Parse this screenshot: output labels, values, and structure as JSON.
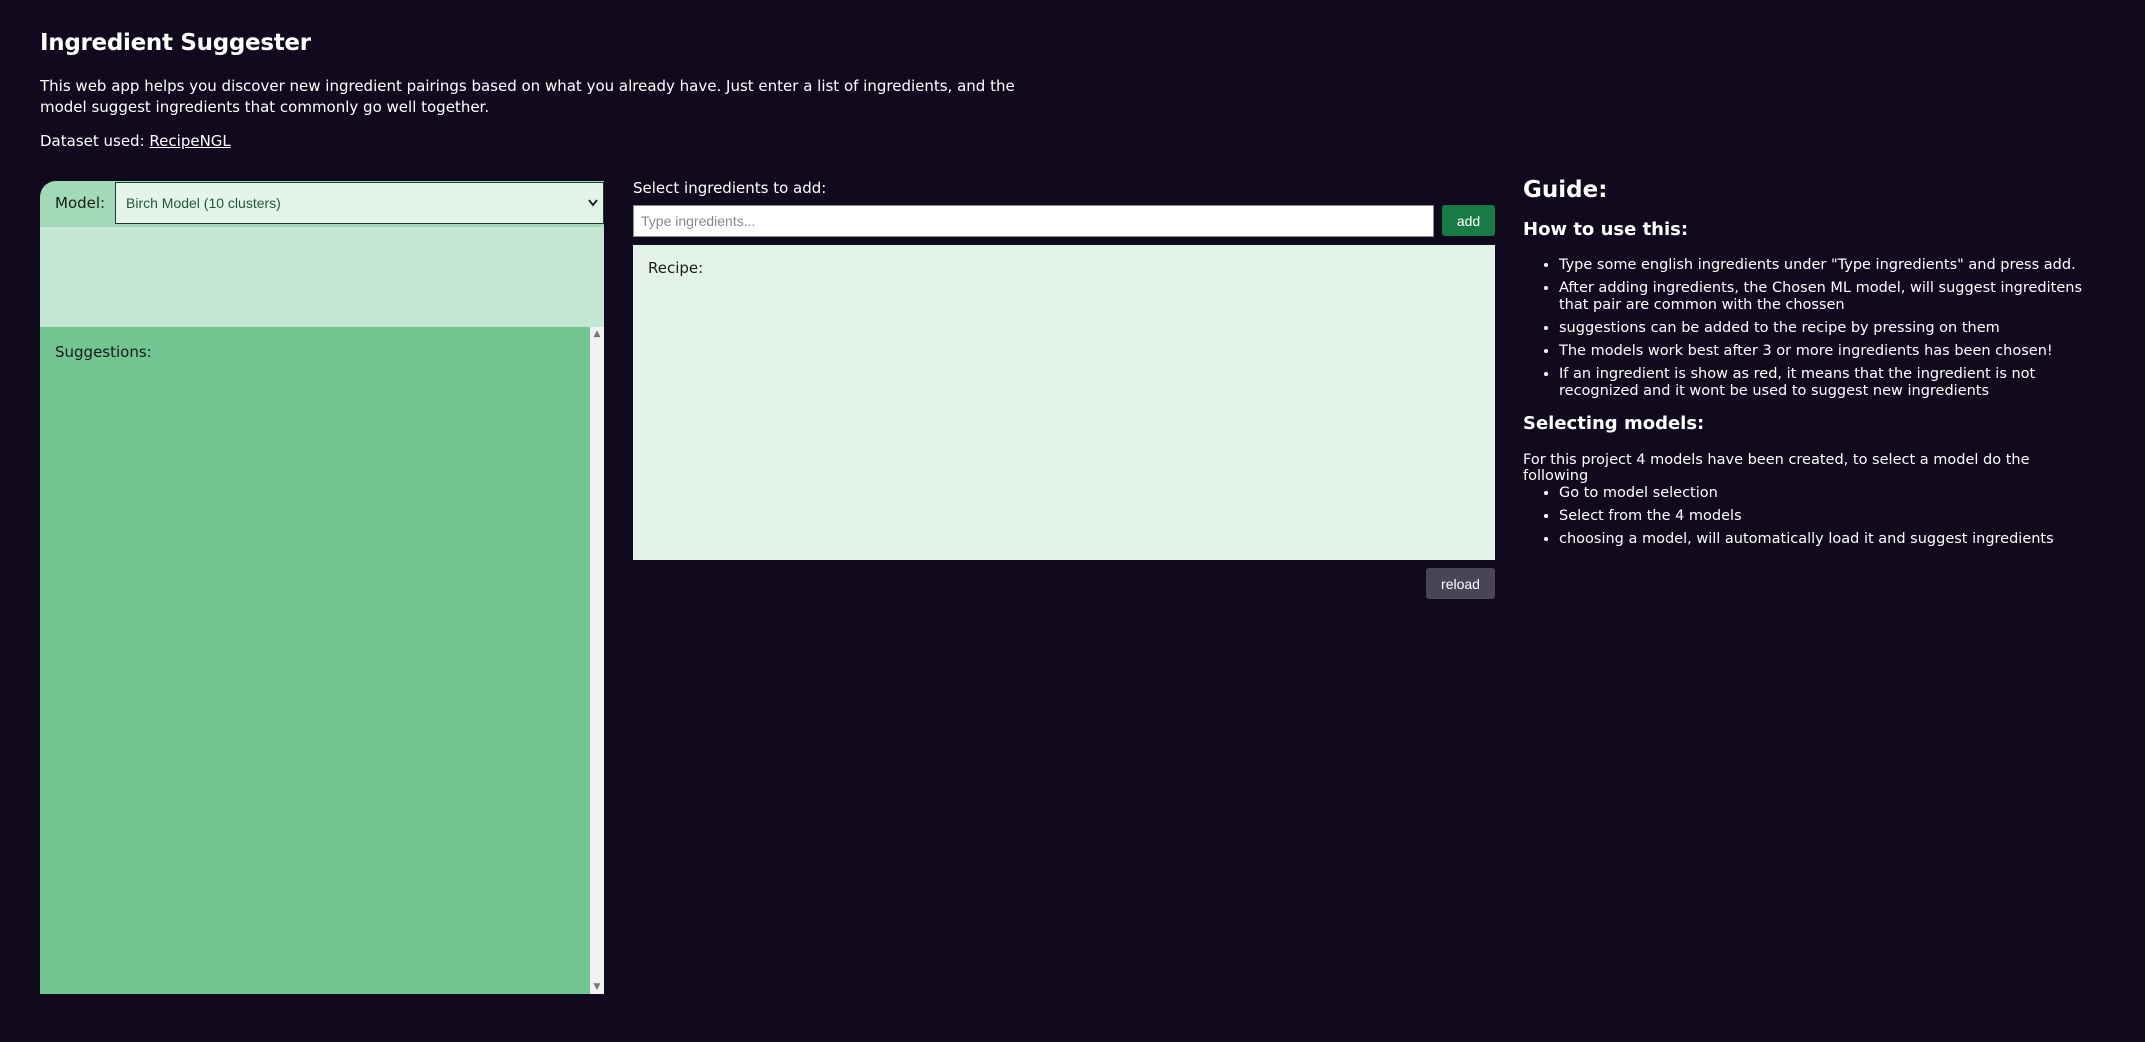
{
  "header": {
    "title": "Ingredient Suggester",
    "description": "This web app helps you discover new ingredient pairings based on what you already have. Just enter a list of ingredients, and the model suggest ingredients that commonly go well together.",
    "dataset_prefix": "Dataset used:",
    "dataset_link": "RecipeNGL"
  },
  "left_panel": {
    "model_label": "Model:",
    "model_selected": "Birch Model (10 clusters)",
    "suggestions_label": "Suggestions:"
  },
  "middle": {
    "select_label": "Select ingredients to add:",
    "input_placeholder": "Type ingredients...",
    "input_value": "",
    "add_label": "add",
    "recipe_label": "Recipe:",
    "reload_label": "reload"
  },
  "guide": {
    "title": "Guide:",
    "how_to_title": "How to use this:",
    "how_to_items": [
      "Type some english ingredients under \"Type ingredients\" and press add.",
      "After adding ingredients, the Chosen ML model, will suggest ingreditens that pair are common with the chossen",
      "suggestions can be added to the recipe by pressing on them",
      "The models work best after 3 or more ingredients has been chosen!",
      "If an ingredient is show as red, it means that the ingredient is not recognized and it wont be used to suggest new ingredients"
    ],
    "selecting_title": "Selecting models:",
    "selecting_intro": "For this project 4 models have been created, to select a model do the following",
    "selecting_items": [
      "Go to model selection",
      "Select from the 4 models",
      "choosing a model, will automatically load it and suggest ingredients"
    ]
  },
  "colors": {
    "background": "#110a1f",
    "model_bar": "#a2d9b8",
    "suggestions_bg": "#73c592",
    "recipe_bg": "#e4f3ea",
    "add_button": "#1a7a45",
    "reload_button": "#4a4556"
  },
  "icons": {
    "select_chevron": "chevron-down-icon",
    "scroll_up": "scroll-up-arrow-icon",
    "scroll_down": "scroll-down-arrow-icon"
  }
}
